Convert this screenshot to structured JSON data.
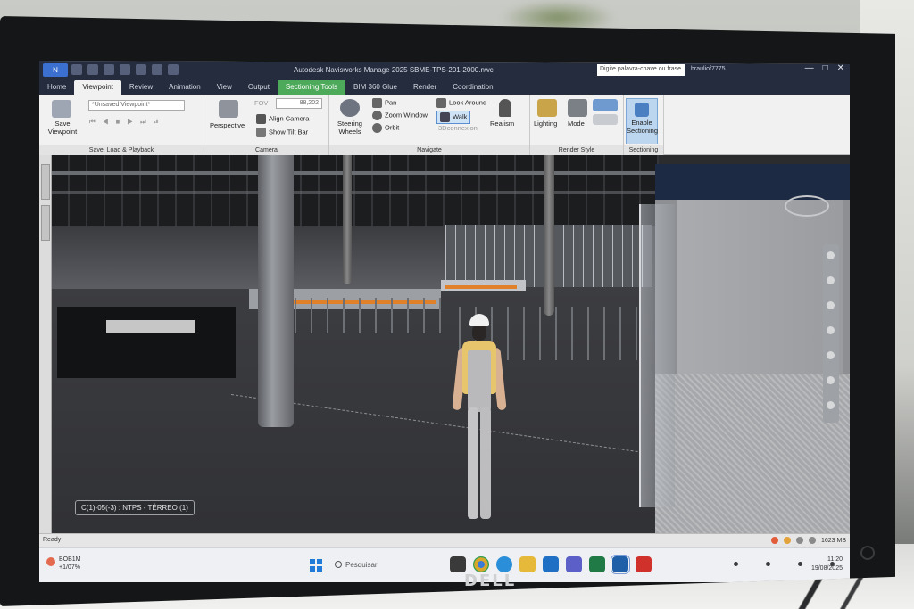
{
  "titlebar": {
    "app_button": "",
    "title": "Autodesk Navisworks Manage 2025    SBME-TPS-201-2000.nwc",
    "help_search_placeholder": "Digite palavra-chave ou frase",
    "user": "brauliof7775",
    "controls": [
      "—",
      "□",
      "✕"
    ]
  },
  "tabs": [
    "Home",
    "Viewpoint",
    "Review",
    "Animation",
    "View",
    "Output",
    "Sectioning Tools",
    "BIM 360 Glue",
    "Render",
    "Coordination"
  ],
  "active_tab": "Viewpoint",
  "context_tab": "Sectioning Tools",
  "ribbon": {
    "save_viewpoint": "Save Viewpoint",
    "viewpoint_dropdown": "*Unsaved Viewpoint*",
    "panel_save": "Save, Load & Playback",
    "perspective": "Perspective",
    "fov_label": "FOV",
    "fov_value": "88,202",
    "align_camera": "Align Camera",
    "show_tilt_bar": "Show Tilt Bar",
    "panel_camera": "Camera",
    "steering_wheels": "Steering Wheels",
    "pan": "Pan",
    "zoom_window": "Zoom Window",
    "orbit": "Orbit",
    "look_around": "Look Around",
    "walk": "Walk",
    "connexion": "3Dconnexion",
    "realism": "Realism",
    "panel_navigate": "Navigate",
    "lighting": "Lighting",
    "mode": "Mode",
    "panel_render": "Render Style",
    "enable_sectioning": "Enable Sectioning",
    "panel_sectioning": "Sectioning"
  },
  "viewport": {
    "viewpoint_label": "C(1)-05(-3) : NTPS - TÉRREO (1)"
  },
  "statusbar": {
    "left": "Ready",
    "memory": "1623 MB",
    "indicator_colors": [
      "#e25b3a",
      "#e2a43a",
      "#8a8a8a",
      "#8a8a8a"
    ]
  },
  "taskbar": {
    "weather_temp": "BOB1M",
    "weather_desc": "+1/07%",
    "search_placeholder": "Pesquisar",
    "apps": [
      {
        "name": "file-explorer-icon",
        "color": "#3a3a3a"
      },
      {
        "name": "chrome-icon",
        "color": "#d9a62c"
      },
      {
        "name": "edge-icon",
        "color": "#2a8fd8"
      },
      {
        "name": "folder-icon",
        "color": "#e6b93b"
      },
      {
        "name": "outlook-icon",
        "color": "#1f6fc4"
      },
      {
        "name": "teams-icon",
        "color": "#5b5fc7"
      },
      {
        "name": "excel-icon",
        "color": "#1f7a45"
      },
      {
        "name": "navisworks-icon",
        "color": "#1e5fa8"
      },
      {
        "name": "acrobat-icon",
        "color": "#d0312b"
      }
    ],
    "time": "11:20",
    "date": "19/08/2025"
  },
  "brand": "DELL"
}
